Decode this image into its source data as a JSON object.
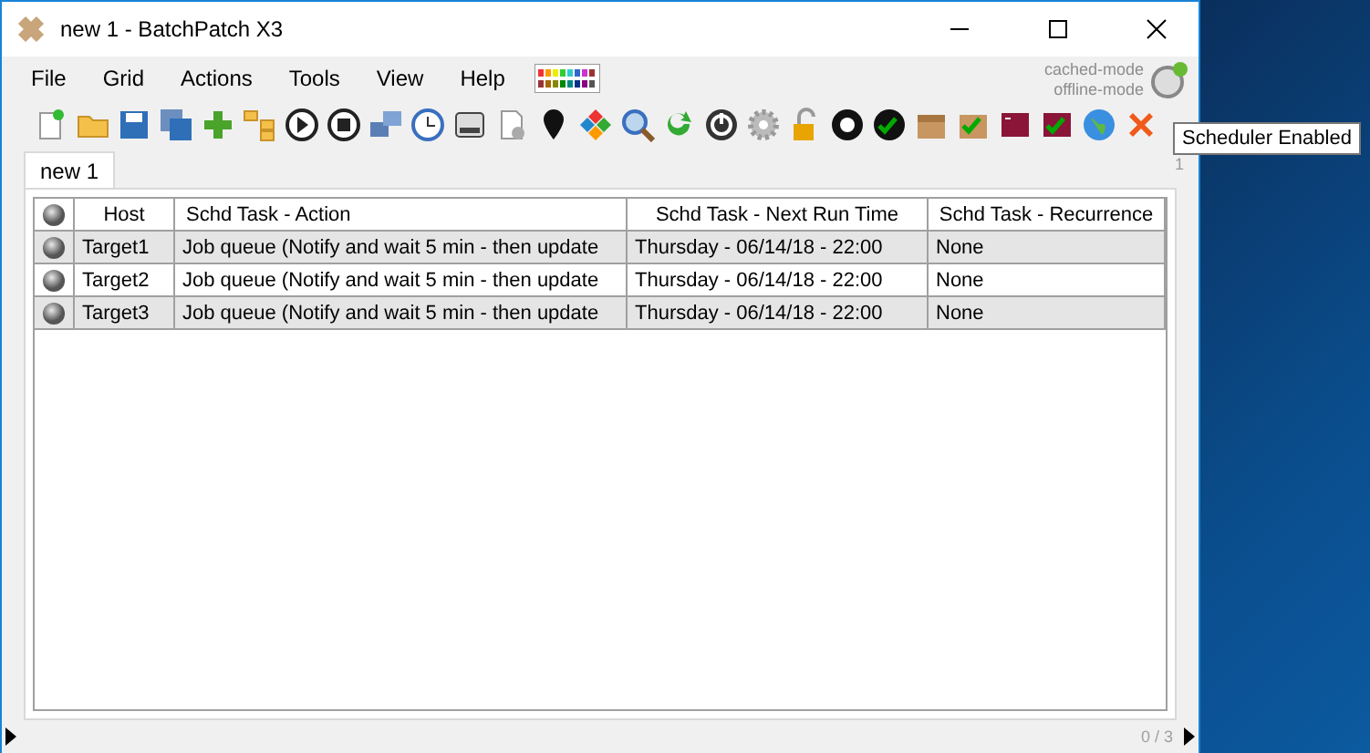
{
  "window": {
    "title": "new 1 - BatchPatch X3"
  },
  "menu": [
    "File",
    "Grid",
    "Actions",
    "Tools",
    "View",
    "Help"
  ],
  "mode_labels": [
    "cached-mode",
    "offline-mode"
  ],
  "tooltip": "Scheduler Enabled",
  "tabs": [
    {
      "label": "new 1",
      "selected": true
    }
  ],
  "tab_counter": "1",
  "table": {
    "columns": [
      "Host",
      "Schd Task - Action",
      "Schd Task - Next Run Time",
      "Schd Task - Recurrence"
    ],
    "rows": [
      [
        "Target1",
        "Job queue (Notify and wait 5 min -  then update",
        "Thursday - 06/14/18 - 22:00",
        "None"
      ],
      [
        "Target2",
        "Job queue (Notify and wait 5 min -  then update",
        "Thursday - 06/14/18 - 22:00",
        "None"
      ],
      [
        "Target3",
        "Job queue (Notify and wait 5 min -  then update",
        "Thursday - 06/14/18 - 22:00",
        "None"
      ]
    ]
  },
  "status_bar": {
    "count": "0 / 3"
  }
}
